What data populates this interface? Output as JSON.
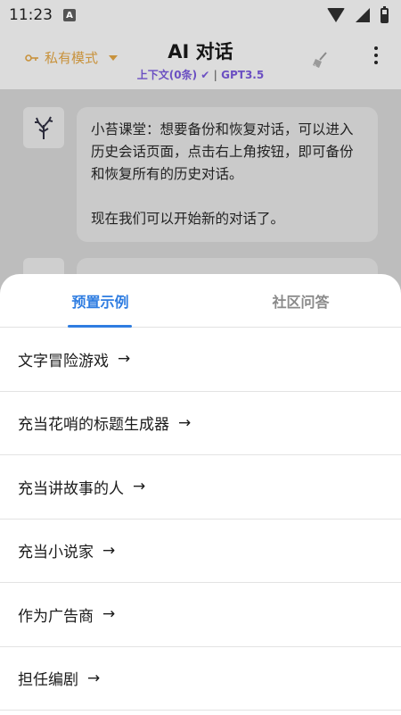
{
  "status": {
    "time": "11:23",
    "notif_icon": "A"
  },
  "header": {
    "mode_label": "私有模式",
    "mode_icon": "key-icon",
    "title": "AI 对话",
    "context": "上下文(0条)",
    "check_glyph": "✔",
    "separator": "|",
    "model": "GPT3.5"
  },
  "chat": {
    "message_paragraphs": [
      "小苔课堂：想要备份和恢复对话，可以进入 历史会话页面，点击右上角按钮，即可备份和恢复所有的历史对话。",
      "现在我们可以开始新的对话了。"
    ]
  },
  "sheet": {
    "tabs": [
      {
        "label": "预置示例",
        "active": true
      },
      {
        "label": "社区问答",
        "active": false
      }
    ],
    "items": [
      {
        "label": "文字冒险游戏",
        "arrow": "→"
      },
      {
        "label": "充当花哨的标题生成器",
        "arrow": "→"
      },
      {
        "label": "充当讲故事的人",
        "arrow": "→"
      },
      {
        "label": "充当小说家",
        "arrow": "→"
      },
      {
        "label": "作为广告商",
        "arrow": "→"
      },
      {
        "label": "担任编剧",
        "arrow": "→"
      }
    ]
  },
  "colors": {
    "accent": "#2f7de1",
    "mode": "#c8923c",
    "subtitle": "#6b4fc2"
  }
}
